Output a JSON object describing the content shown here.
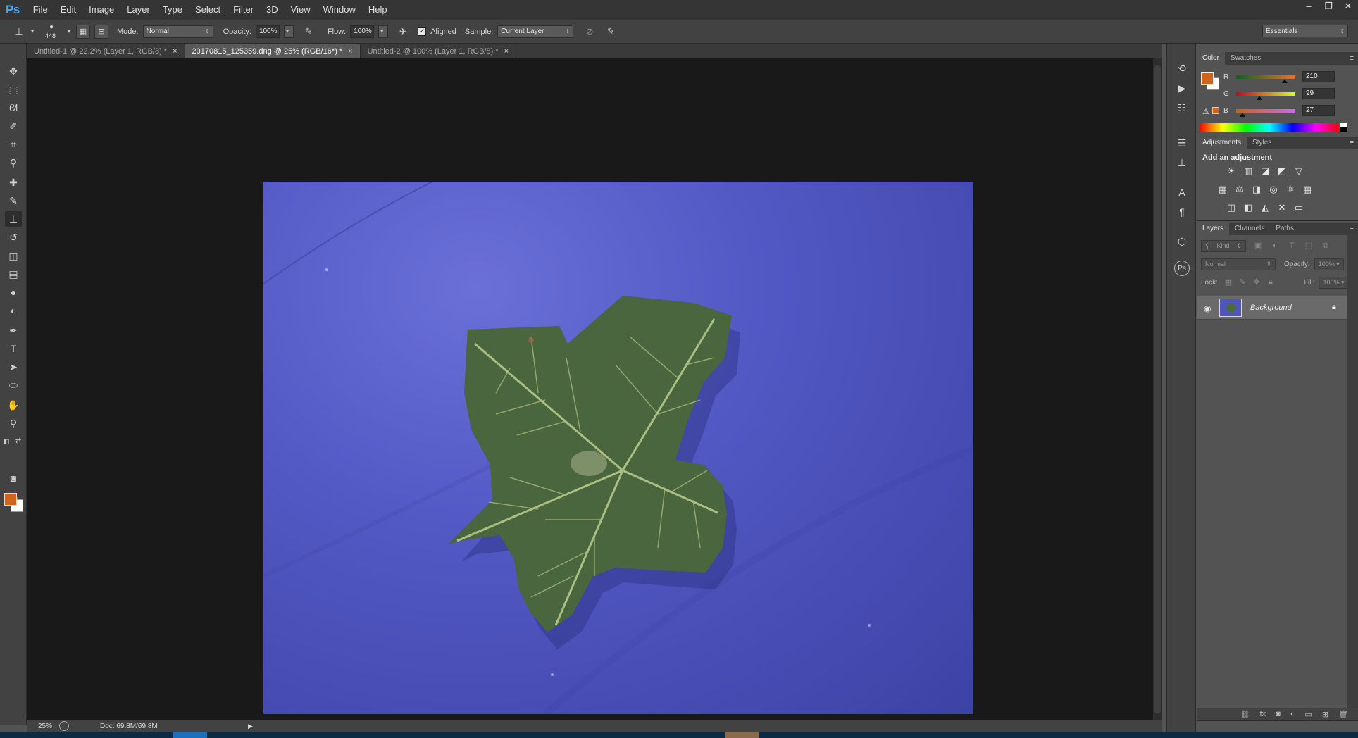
{
  "app": {
    "logo": "Ps"
  },
  "menu": [
    "File",
    "Edit",
    "Image",
    "Layer",
    "Type",
    "Select",
    "Filter",
    "3D",
    "View",
    "Window",
    "Help"
  ],
  "window_controls": {
    "minimize": "–",
    "restore": "❐",
    "close": "✕"
  },
  "options": {
    "brush_size": "448",
    "mode_label": "Mode:",
    "mode_value": "Normal",
    "opacity_label": "Opacity:",
    "opacity_value": "100%",
    "flow_label": "Flow:",
    "flow_value": "100%",
    "aligned_label": "Aligned",
    "aligned_checked": true,
    "sample_label": "Sample:",
    "sample_value": "Current Layer",
    "workspace": "Essentials"
  },
  "tabs": [
    {
      "label": "Untitled-1 @ 22.2% (Layer 1, RGB/8) *",
      "active": false
    },
    {
      "label": "20170815_125359.dng @ 25% (RGB/16*) *",
      "active": true
    },
    {
      "label": "Untitled-2 @ 100% (Layer 1, RGB/8) *",
      "active": false
    }
  ],
  "status": {
    "zoom": "25%",
    "doc": "Doc: 69.8M/69.8M"
  },
  "color_panel": {
    "tabs": [
      "Color",
      "Swatches"
    ],
    "r_label": "R",
    "g_label": "G",
    "b_label": "B",
    "r": "210",
    "g": "99",
    "b": "27",
    "r_level": 0.82,
    "g_level": 0.39,
    "b_level": 0.11,
    "foreground": "#d2631b",
    "background": "#ffffff"
  },
  "adjustments_panel": {
    "tabs": [
      "Adjustments",
      "Styles"
    ],
    "title": "Add an adjustment"
  },
  "layers_panel": {
    "tabs": [
      "Layers",
      "Channels",
      "Paths"
    ],
    "kind_filter": "Kind",
    "blend_mode": "Normal",
    "opacity_label": "Opacity:",
    "opacity_value": "100%",
    "lock_label": "Lock:",
    "fill_label": "Fill:",
    "fill_value": "100%",
    "layer_name": "Background"
  },
  "icons": {
    "eye": "visibility-eye-icon",
    "lock": "layer-lock-icon",
    "clone_stamp": "clone-stamp-icon"
  }
}
